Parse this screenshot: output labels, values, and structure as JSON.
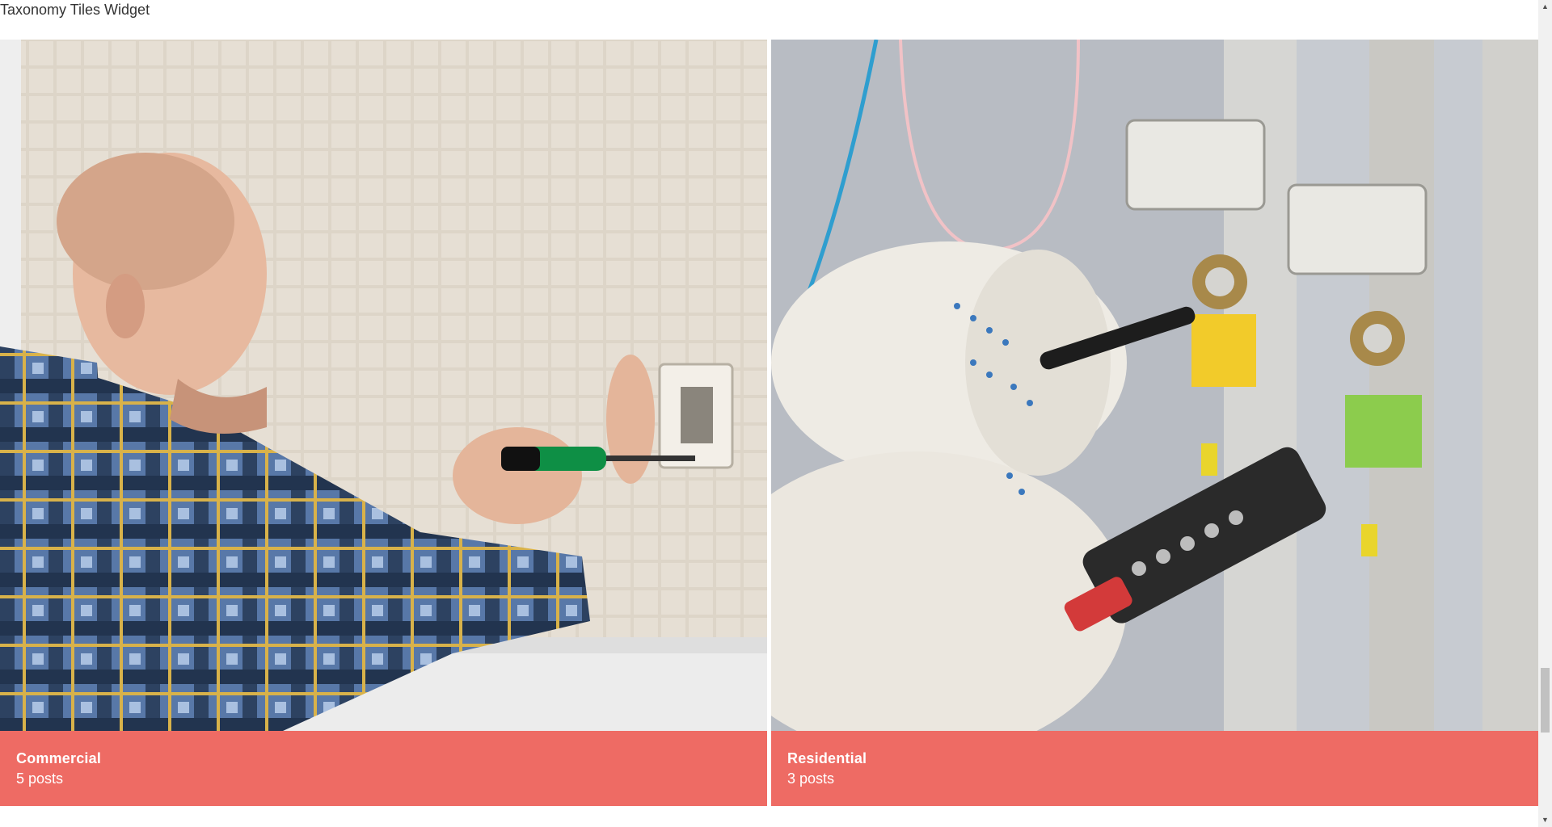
{
  "widget": {
    "title": "Taxonomy Tiles Widget"
  },
  "tiles": [
    {
      "name": "Commercial",
      "count_label": "5 posts",
      "image_icon": "electrician-installing-outlet-image"
    },
    {
      "name": "Residential",
      "count_label": "3 posts",
      "image_icon": "voltage-tester-panel-image"
    }
  ],
  "colors": {
    "caption_bg": "#ee6b64",
    "caption_text": "#ffffff",
    "title_text": "#333333"
  },
  "scrollbar": {
    "up_icon": "arrow-up-icon",
    "down_icon": "arrow-down-icon"
  }
}
